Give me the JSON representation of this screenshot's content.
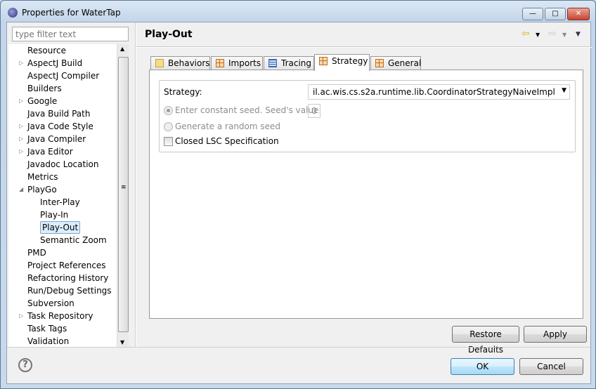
{
  "window": {
    "title": "Properties for WaterTap",
    "minimize": "—",
    "maximize": "□",
    "close": "✕"
  },
  "filter": {
    "placeholder": "type filter text"
  },
  "tree": {
    "items": [
      {
        "label": "Resource",
        "level": 0,
        "expander": ""
      },
      {
        "label": "AspectJ Build",
        "level": 0,
        "expander": "▷"
      },
      {
        "label": "AspectJ Compiler",
        "level": 0,
        "expander": ""
      },
      {
        "label": "Builders",
        "level": 0,
        "expander": ""
      },
      {
        "label": "Google",
        "level": 0,
        "expander": "▷"
      },
      {
        "label": "Java Build Path",
        "level": 0,
        "expander": ""
      },
      {
        "label": "Java Code Style",
        "level": 0,
        "expander": "▷"
      },
      {
        "label": "Java Compiler",
        "level": 0,
        "expander": "▷"
      },
      {
        "label": "Java Editor",
        "level": 0,
        "expander": "▷"
      },
      {
        "label": "Javadoc Location",
        "level": 0,
        "expander": ""
      },
      {
        "label": "Metrics",
        "level": 0,
        "expander": ""
      },
      {
        "label": "PlayGo",
        "level": 0,
        "expander": "◢"
      },
      {
        "label": "Inter-Play",
        "level": 1,
        "expander": ""
      },
      {
        "label": "Play-In",
        "level": 1,
        "expander": ""
      },
      {
        "label": "Play-Out",
        "level": 1,
        "expander": "",
        "selected": true
      },
      {
        "label": "Semantic Zoom",
        "level": 1,
        "expander": ""
      },
      {
        "label": "PMD",
        "level": 0,
        "expander": ""
      },
      {
        "label": "Project References",
        "level": 0,
        "expander": ""
      },
      {
        "label": "Refactoring History",
        "level": 0,
        "expander": ""
      },
      {
        "label": "Run/Debug Settings",
        "level": 0,
        "expander": ""
      },
      {
        "label": "Subversion",
        "level": 0,
        "expander": ""
      },
      {
        "label": "Task Repository",
        "level": 0,
        "expander": "▷"
      },
      {
        "label": "Task Tags",
        "level": 0,
        "expander": ""
      },
      {
        "label": "Validation",
        "level": 0,
        "expander": ""
      }
    ]
  },
  "header": {
    "title": "Play-Out",
    "back": "⇦",
    "forward": "⇨",
    "dropdown": "▼"
  },
  "tabs": [
    {
      "label": "Behaviors",
      "icon": "behaviors-icon"
    },
    {
      "label": "Imports",
      "icon": "grid-icon"
    },
    {
      "label": "Tracing",
      "icon": "tracing-icon"
    },
    {
      "label": "Strategy",
      "icon": "grid-icon",
      "active": true
    },
    {
      "label": "General",
      "icon": "grid-icon"
    }
  ],
  "strategy": {
    "label": "Strategy:",
    "value": "il.ac.wis.cs.s2a.runtime.lib.CoordinatorStrategyNaiveImpl",
    "constant_seed_label": "Enter constant seed. Seed's value:",
    "seed_value": "0",
    "random_seed_label": "Generate a random seed",
    "closed_lsc_label": "Closed LSC Specification"
  },
  "buttons": {
    "restore_defaults": "Restore Defaults",
    "apply": "Apply",
    "ok": "OK",
    "cancel": "Cancel",
    "help": "?"
  }
}
